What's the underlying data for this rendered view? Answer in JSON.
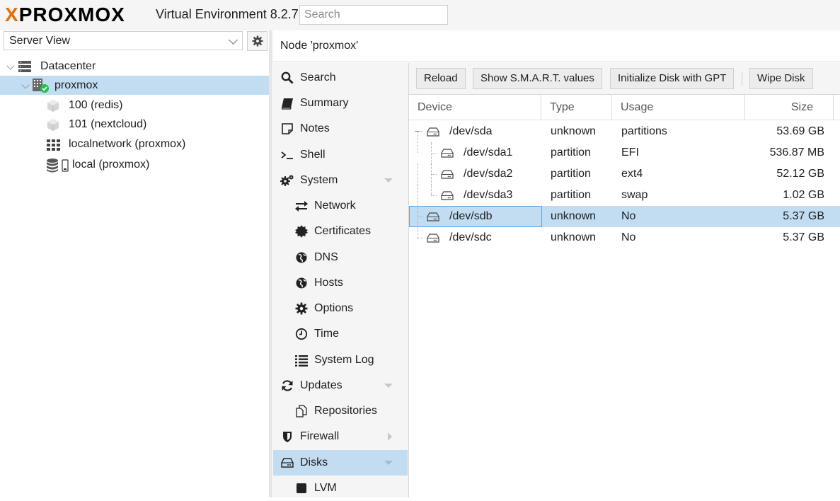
{
  "header": {
    "logo_text_left": "X",
    "logo_text_main": "PROXMOX",
    "version": "Virtual Environment 8.2.7",
    "search_placeholder": "Search"
  },
  "tree": {
    "view_label": "Server View",
    "items": [
      {
        "label": "Datacenter",
        "icon": "datacenter-icon"
      },
      {
        "label": "proxmox",
        "icon": "node-online-icon",
        "selected": true
      },
      {
        "label": "100 (redis)",
        "icon": "container-icon"
      },
      {
        "label": "101 (nextcloud)",
        "icon": "container-icon"
      },
      {
        "label": "localnetwork (proxmox)",
        "icon": "sdn-icon"
      },
      {
        "label": "local (proxmox)",
        "icon": "storage-icon"
      }
    ]
  },
  "content": {
    "title": "Node 'proxmox'"
  },
  "nav": {
    "items": [
      {
        "label": "Search",
        "icon": "search-icon"
      },
      {
        "label": "Summary",
        "icon": "book-icon"
      },
      {
        "label": "Notes",
        "icon": "notes-icon"
      },
      {
        "label": "Shell",
        "icon": "terminal-icon"
      },
      {
        "label": "System",
        "icon": "cogs-icon",
        "expandable": true
      },
      {
        "label": "Network",
        "icon": "exchange-icon"
      },
      {
        "label": "Certificates",
        "icon": "certificate-icon"
      },
      {
        "label": "DNS",
        "icon": "globe-icon"
      },
      {
        "label": "Hosts",
        "icon": "globe-icon"
      },
      {
        "label": "Options",
        "icon": "gear-icon"
      },
      {
        "label": "Time",
        "icon": "clock-icon"
      },
      {
        "label": "System Log",
        "icon": "list-icon"
      },
      {
        "label": "Updates",
        "icon": "refresh-icon",
        "expandable": true
      },
      {
        "label": "Repositories",
        "icon": "files-icon"
      },
      {
        "label": "Firewall",
        "icon": "shield-icon",
        "collapsed": true
      },
      {
        "label": "Disks",
        "icon": "hdd-icon",
        "selected": true,
        "expandable": true
      },
      {
        "label": "LVM",
        "icon": "square-icon"
      }
    ]
  },
  "toolbar": {
    "reload": "Reload",
    "smart": "Show S.M.A.R.T. values",
    "init_gpt": "Initialize Disk with GPT",
    "wipe": "Wipe Disk"
  },
  "grid": {
    "columns": [
      "Device",
      "Type",
      "Usage",
      "Size"
    ],
    "rows": [
      {
        "device": "/dev/sda",
        "type": "unknown",
        "usage": "partitions",
        "size": "53.69 GB"
      },
      {
        "device": "/dev/sda1",
        "type": "partition",
        "usage": "EFI",
        "size": "536.87 MB"
      },
      {
        "device": "/dev/sda2",
        "type": "partition",
        "usage": "ext4",
        "size": "52.12 GB"
      },
      {
        "device": "/dev/sda3",
        "type": "partition",
        "usage": "swap",
        "size": "1.02 GB"
      },
      {
        "device": "/dev/sdb",
        "type": "unknown",
        "usage": "No",
        "size": "5.37 GB",
        "selected": true
      },
      {
        "device": "/dev/sdc",
        "type": "unknown",
        "usage": "No",
        "size": "5.37 GB"
      }
    ]
  },
  "colors": {
    "brand_orange": "#e57000",
    "selection": "#c2ddf2",
    "online_green": "#21bf4b"
  }
}
